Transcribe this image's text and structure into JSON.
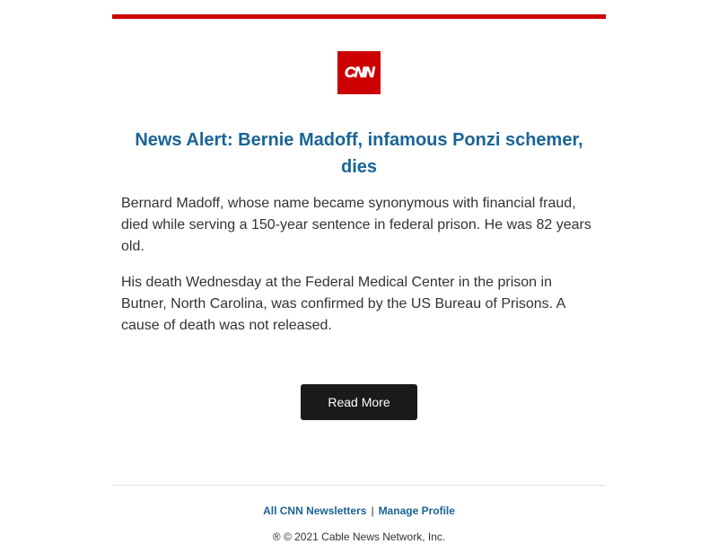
{
  "colors": {
    "brand_red": "#cc0000",
    "headline_blue": "#1a6496",
    "link_blue": "#1a6496",
    "button_bg": "#1a1a1a",
    "text": "#333333"
  },
  "logo": {
    "text": "CNN",
    "icon": "cnn-logo"
  },
  "article": {
    "headline": "News Alert: Bernie Madoff, infamous Ponzi schemer, dies",
    "paragraphs": [
      "Bernard Madoff, whose name became synonymous with financial fraud, died while serving a 150-year sentence in federal prison. He was 82 years old.",
      "His death Wednesday at the Federal Medical Center in the prison in Butner, North Carolina, was confirmed by the US Bureau of Prisons. A cause of death was not released."
    ]
  },
  "cta": {
    "label": "Read More"
  },
  "footer": {
    "link_all_newsletters": "All CNN Newsletters",
    "separator": "|",
    "link_manage_profile": "Manage Profile",
    "copyright": "® © 2021 Cable News Network, Inc."
  }
}
